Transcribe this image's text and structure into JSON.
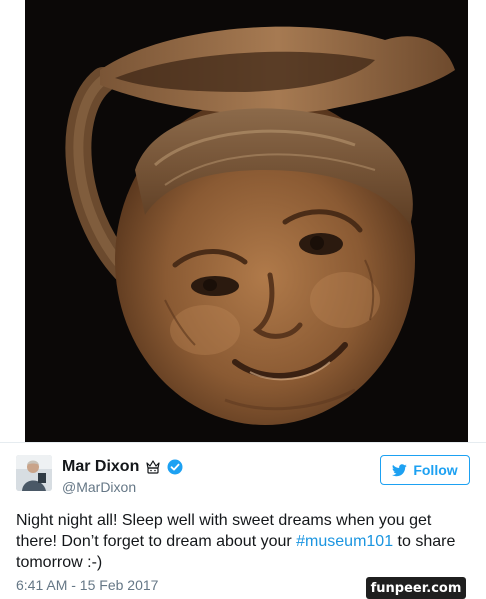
{
  "tweet": {
    "display_name": "Mar Dixon",
    "handle": "@MarDixon",
    "follow_label": "Follow",
    "text_before": "Night night all! Sleep well with sweet dreams when you get there! Don’t forget to dream about your ",
    "hashtag": "#museum101",
    "text_after": " to share tomorrow :-)",
    "timestamp": "6:41 AM - 15 Feb 2017",
    "media_subject": "carved face jug",
    "icons": {
      "emoji": "crowned-emoji-icon",
      "verified": "verified-badge-icon",
      "follow": "twitter-bird-icon"
    }
  },
  "watermark": {
    "text": "funpeer.com"
  },
  "colors": {
    "accent": "#1da1f2",
    "hashtag": "#1b95e0",
    "secondary_text": "#657786",
    "primary_text": "#14171a"
  }
}
